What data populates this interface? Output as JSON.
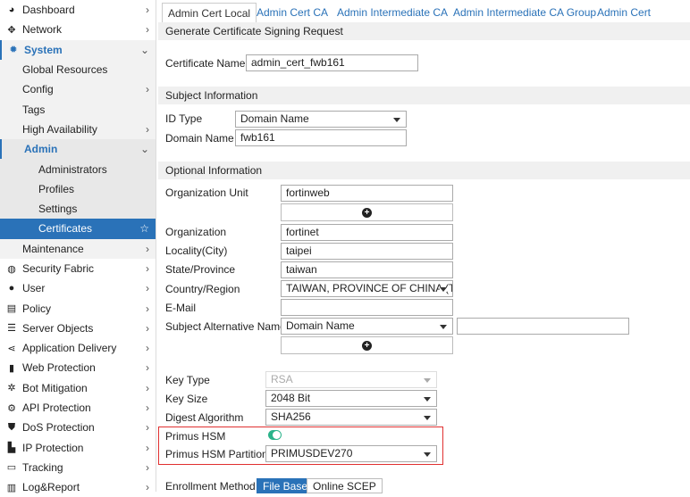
{
  "sidebar": {
    "items": [
      {
        "label": "Dashboard",
        "icon": "dashboard-icon"
      },
      {
        "label": "Network",
        "icon": "network-icon"
      },
      {
        "label": "System",
        "icon": "gear-icon"
      },
      {
        "label": "Global Resources"
      },
      {
        "label": "Config"
      },
      {
        "label": "Tags"
      },
      {
        "label": "High Availability"
      },
      {
        "label": "Admin"
      },
      {
        "label": "Administrators"
      },
      {
        "label": "Profiles"
      },
      {
        "label": "Settings"
      },
      {
        "label": "Certificates"
      },
      {
        "label": "Maintenance"
      },
      {
        "label": "Security Fabric",
        "icon": "fabric-icon"
      },
      {
        "label": "User",
        "icon": "user-icon"
      },
      {
        "label": "Policy",
        "icon": "policy-icon"
      },
      {
        "label": "Server Objects",
        "icon": "server-icon"
      },
      {
        "label": "Application Delivery",
        "icon": "delivery-icon"
      },
      {
        "label": "Web Protection",
        "icon": "lock-icon"
      },
      {
        "label": "Bot Mitigation",
        "icon": "bot-icon"
      },
      {
        "label": "API Protection",
        "icon": "api-icon"
      },
      {
        "label": "DoS Protection",
        "icon": "shield-icon"
      },
      {
        "label": "IP Protection",
        "icon": "ip-icon"
      },
      {
        "label": "Tracking",
        "icon": "tracking-icon"
      },
      {
        "label": "Log&Report",
        "icon": "chart-icon"
      }
    ]
  },
  "tabs": [
    "Admin Cert Local",
    "Admin Cert CA",
    "Admin Intermediate CA",
    "Admin Intermediate CA Group",
    "Admin Cert Remote"
  ],
  "form": {
    "section_csr": "Generate Certificate Signing Request",
    "cert_name_label": "Certificate Name",
    "cert_name": "admin_cert_fwb161",
    "section_subject": "Subject Information",
    "id_type_label": "ID Type",
    "id_type": "Domain Name",
    "domain_label": "Domain Name",
    "domain": "fwb161",
    "section_optional": "Optional Information",
    "org_unit_label": "Organization Unit",
    "org_unit": "fortinweb",
    "org_label": "Organization",
    "org": "fortinet",
    "locality_label": "Locality(City)",
    "locality": "taipei",
    "state_label": "State/Province",
    "state": "taiwan",
    "country_label": "Country/Region",
    "country": "TAIWAN, PROVINCE OF CHINA (TW)",
    "email_label": "E-Mail",
    "email": "",
    "san_label": "Subject Alternative Name",
    "san_type": "Domain Name",
    "san_value": "",
    "key_type_label": "Key Type",
    "key_type": "RSA",
    "key_size_label": "Key Size",
    "key_size": "2048 Bit",
    "digest_label": "Digest Algorithm",
    "digest": "SHA256",
    "hsm_label": "Primus HSM",
    "hsm_enabled": true,
    "partition_label": "Primus HSM Partition",
    "partition": "PRIMUSDEV270",
    "enroll_label": "Enrollment Method",
    "enroll_options": [
      "File Based",
      "Online SCEP"
    ]
  },
  "colors": {
    "accent": "#2a72b8",
    "toggle": "#2bb38a",
    "highlight": "#e03030"
  }
}
